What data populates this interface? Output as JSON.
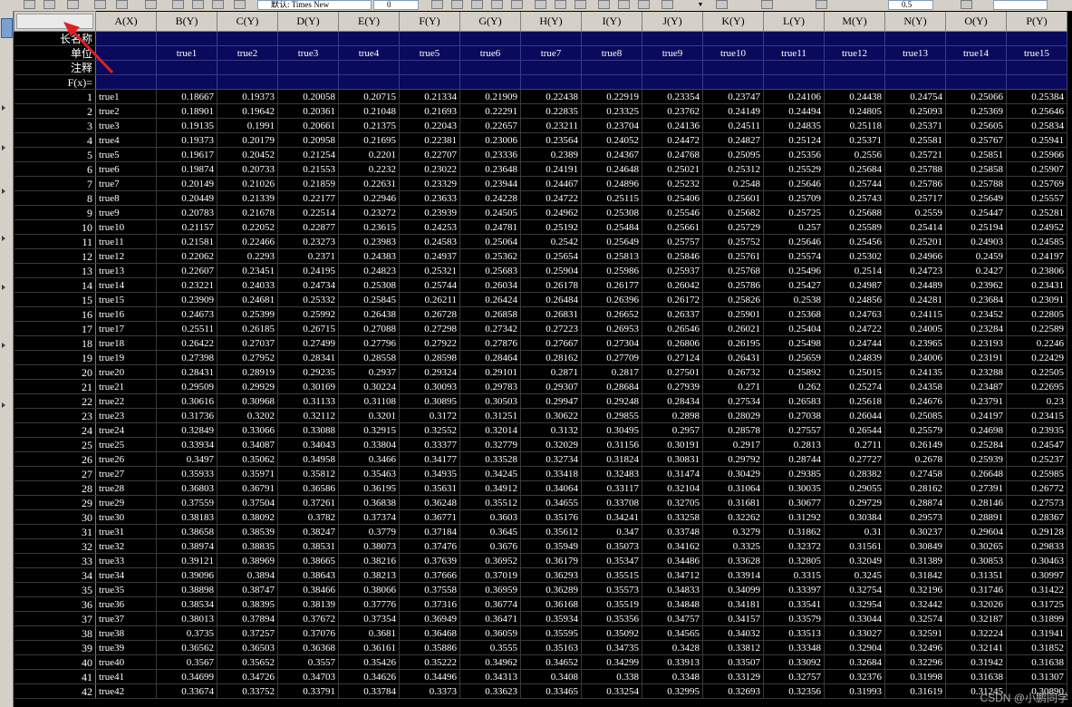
{
  "toolbar": {
    "font_name": "默认: Times New",
    "font_size": "0",
    "format_value": "0.5"
  },
  "sheet": {
    "columns": [
      "A(X)",
      "B(Y)",
      "C(Y)",
      "D(Y)",
      "E(Y)",
      "F(Y)",
      "G(Y)",
      "H(Y)",
      "I(Y)",
      "J(Y)",
      "K(Y)",
      "L(Y)",
      "M(Y)",
      "N(Y)",
      "O(Y)",
      "P(Y)"
    ],
    "meta_labels": {
      "long_name": "长名称",
      "units": "单位",
      "comments": "注释",
      "fx": "F(x)="
    },
    "units_row": [
      "",
      "true1",
      "true2",
      "true3",
      "true4",
      "true5",
      "true6",
      "true7",
      "true8",
      "true9",
      "true10",
      "true11",
      "true12",
      "true13",
      "true14",
      "true15"
    ],
    "rows": [
      [
        "1",
        "true1",
        "0.18667",
        "0.19373",
        "0.20058",
        "0.20715",
        "0.21334",
        "0.21909",
        "0.22438",
        "0.22919",
        "0.23354",
        "0.23747",
        "0.24106",
        "0.24438",
        "0.24754",
        "0.25066",
        "0.25384"
      ],
      [
        "2",
        "true2",
        "0.18901",
        "0.19642",
        "0.20361",
        "0.21048",
        "0.21693",
        "0.22291",
        "0.22835",
        "0.23325",
        "0.23762",
        "0.24149",
        "0.24494",
        "0.24805",
        "0.25093",
        "0.25369",
        "0.25646"
      ],
      [
        "3",
        "true3",
        "0.19135",
        "0.1991",
        "0.20661",
        "0.21375",
        "0.22043",
        "0.22657",
        "0.23211",
        "0.23704",
        "0.24136",
        "0.24511",
        "0.24835",
        "0.25118",
        "0.25371",
        "0.25605",
        "0.25834"
      ],
      [
        "4",
        "true4",
        "0.19373",
        "0.20179",
        "0.20958",
        "0.21695",
        "0.22381",
        "0.23006",
        "0.23564",
        "0.24052",
        "0.24472",
        "0.24827",
        "0.25124",
        "0.25371",
        "0.25581",
        "0.25767",
        "0.25941"
      ],
      [
        "5",
        "true5",
        "0.19617",
        "0.20452",
        "0.21254",
        "0.2201",
        "0.22707",
        "0.23336",
        "0.2389",
        "0.24367",
        "0.24768",
        "0.25095",
        "0.25356",
        "0.2556",
        "0.25721",
        "0.25851",
        "0.25966"
      ],
      [
        "6",
        "true6",
        "0.19874",
        "0.20733",
        "0.21553",
        "0.2232",
        "0.23022",
        "0.23648",
        "0.24191",
        "0.24648",
        "0.25021",
        "0.25312",
        "0.25529",
        "0.25684",
        "0.25788",
        "0.25858",
        "0.25907"
      ],
      [
        "7",
        "true7",
        "0.20149",
        "0.21026",
        "0.21859",
        "0.22631",
        "0.23329",
        "0.23944",
        "0.24467",
        "0.24896",
        "0.25232",
        "0.2548",
        "0.25646",
        "0.25744",
        "0.25786",
        "0.25788",
        "0.25769"
      ],
      [
        "8",
        "true8",
        "0.20449",
        "0.21339",
        "0.22177",
        "0.22946",
        "0.23633",
        "0.24228",
        "0.24722",
        "0.25115",
        "0.25406",
        "0.25601",
        "0.25709",
        "0.25743",
        "0.25717",
        "0.25649",
        "0.25557"
      ],
      [
        "9",
        "true9",
        "0.20783",
        "0.21678",
        "0.22514",
        "0.23272",
        "0.23939",
        "0.24505",
        "0.24962",
        "0.25308",
        "0.25546",
        "0.25682",
        "0.25725",
        "0.25688",
        "0.2559",
        "0.25447",
        "0.25281"
      ],
      [
        "10",
        "true10",
        "0.21157",
        "0.22052",
        "0.22877",
        "0.23615",
        "0.24253",
        "0.24781",
        "0.25192",
        "0.25484",
        "0.25661",
        "0.25729",
        "0.257",
        "0.25589",
        "0.25414",
        "0.25194",
        "0.24952"
      ],
      [
        "11",
        "true11",
        "0.21581",
        "0.22466",
        "0.23273",
        "0.23983",
        "0.24583",
        "0.25064",
        "0.2542",
        "0.25649",
        "0.25757",
        "0.25752",
        "0.25646",
        "0.25456",
        "0.25201",
        "0.24903",
        "0.24585"
      ],
      [
        "12",
        "true12",
        "0.22062",
        "0.2293",
        "0.2371",
        "0.24383",
        "0.24937",
        "0.25362",
        "0.25654",
        "0.25813",
        "0.25846",
        "0.25761",
        "0.25574",
        "0.25302",
        "0.24966",
        "0.2459",
        "0.24197"
      ],
      [
        "13",
        "true13",
        "0.22607",
        "0.23451",
        "0.24195",
        "0.24823",
        "0.25321",
        "0.25683",
        "0.25904",
        "0.25986",
        "0.25937",
        "0.25768",
        "0.25496",
        "0.2514",
        "0.24723",
        "0.2427",
        "0.23806"
      ],
      [
        "14",
        "true14",
        "0.23221",
        "0.24033",
        "0.24734",
        "0.25308",
        "0.25744",
        "0.26034",
        "0.26178",
        "0.26177",
        "0.26042",
        "0.25786",
        "0.25427",
        "0.24987",
        "0.24489",
        "0.23962",
        "0.23431"
      ],
      [
        "15",
        "true15",
        "0.23909",
        "0.24681",
        "0.25332",
        "0.25845",
        "0.26211",
        "0.26424",
        "0.26484",
        "0.26396",
        "0.26172",
        "0.25826",
        "0.2538",
        "0.24856",
        "0.24281",
        "0.23684",
        "0.23091"
      ],
      [
        "16",
        "true16",
        "0.24673",
        "0.25399",
        "0.25992",
        "0.26438",
        "0.26728",
        "0.26858",
        "0.26831",
        "0.26652",
        "0.26337",
        "0.25901",
        "0.25368",
        "0.24763",
        "0.24115",
        "0.23452",
        "0.22805"
      ],
      [
        "17",
        "true17",
        "0.25511",
        "0.26185",
        "0.26715",
        "0.27088",
        "0.27298",
        "0.27342",
        "0.27223",
        "0.26953",
        "0.26546",
        "0.26021",
        "0.25404",
        "0.24722",
        "0.24005",
        "0.23284",
        "0.22589"
      ],
      [
        "18",
        "true18",
        "0.26422",
        "0.27037",
        "0.27499",
        "0.27796",
        "0.27922",
        "0.27876",
        "0.27667",
        "0.27304",
        "0.26806",
        "0.26195",
        "0.25498",
        "0.24744",
        "0.23965",
        "0.23193",
        "0.2246"
      ],
      [
        "19",
        "true19",
        "0.27398",
        "0.27952",
        "0.28341",
        "0.28558",
        "0.28598",
        "0.28464",
        "0.28162",
        "0.27709",
        "0.27124",
        "0.26431",
        "0.25659",
        "0.24839",
        "0.24006",
        "0.23191",
        "0.22429"
      ],
      [
        "20",
        "true20",
        "0.28431",
        "0.28919",
        "0.29235",
        "0.2937",
        "0.29324",
        "0.29101",
        "0.2871",
        "0.2817",
        "0.27501",
        "0.26732",
        "0.25892",
        "0.25015",
        "0.24135",
        "0.23288",
        "0.22505"
      ],
      [
        "21",
        "true21",
        "0.29509",
        "0.29929",
        "0.30169",
        "0.30224",
        "0.30093",
        "0.29783",
        "0.29307",
        "0.28684",
        "0.27939",
        "0.271",
        "0.262",
        "0.25274",
        "0.24358",
        "0.23487",
        "0.22695"
      ],
      [
        "22",
        "true22",
        "0.30616",
        "0.30968",
        "0.31133",
        "0.31108",
        "0.30895",
        "0.30503",
        "0.29947",
        "0.29248",
        "0.28434",
        "0.27534",
        "0.26583",
        "0.25618",
        "0.24676",
        "0.23791",
        "0.23"
      ],
      [
        "23",
        "true23",
        "0.31736",
        "0.3202",
        "0.32112",
        "0.3201",
        "0.3172",
        "0.31251",
        "0.30622",
        "0.29855",
        "0.2898",
        "0.28029",
        "0.27038",
        "0.26044",
        "0.25085",
        "0.24197",
        "0.23415"
      ],
      [
        "24",
        "true24",
        "0.32849",
        "0.33066",
        "0.33088",
        "0.32915",
        "0.32552",
        "0.32014",
        "0.3132",
        "0.30495",
        "0.2957",
        "0.28578",
        "0.27557",
        "0.26544",
        "0.25579",
        "0.24698",
        "0.23935"
      ],
      [
        "25",
        "true25",
        "0.33934",
        "0.34087",
        "0.34043",
        "0.33804",
        "0.33377",
        "0.32779",
        "0.32029",
        "0.31156",
        "0.30191",
        "0.2917",
        "0.2813",
        "0.2711",
        "0.26149",
        "0.25284",
        "0.24547"
      ],
      [
        "26",
        "true26",
        "0.3497",
        "0.35062",
        "0.34958",
        "0.3466",
        "0.34177",
        "0.33528",
        "0.32734",
        "0.31824",
        "0.30831",
        "0.29792",
        "0.28744",
        "0.27727",
        "0.2678",
        "0.25939",
        "0.25237"
      ],
      [
        "27",
        "true27",
        "0.35933",
        "0.35971",
        "0.35812",
        "0.35463",
        "0.34935",
        "0.34245",
        "0.33418",
        "0.32483",
        "0.31474",
        "0.30429",
        "0.29385",
        "0.28382",
        "0.27458",
        "0.26648",
        "0.25985"
      ],
      [
        "28",
        "true28",
        "0.36803",
        "0.36791",
        "0.36586",
        "0.36195",
        "0.35631",
        "0.34912",
        "0.34064",
        "0.33117",
        "0.32104",
        "0.31064",
        "0.30035",
        "0.29055",
        "0.28162",
        "0.27391",
        "0.26772"
      ],
      [
        "29",
        "true29",
        "0.37559",
        "0.37504",
        "0.37261",
        "0.36838",
        "0.36248",
        "0.35512",
        "0.34655",
        "0.33708",
        "0.32705",
        "0.31681",
        "0.30677",
        "0.29729",
        "0.28874",
        "0.28146",
        "0.27573"
      ],
      [
        "30",
        "true30",
        "0.38183",
        "0.38092",
        "0.3782",
        "0.37374",
        "0.36771",
        "0.3603",
        "0.35176",
        "0.34241",
        "0.33258",
        "0.32262",
        "0.31292",
        "0.30384",
        "0.29573",
        "0.28891",
        "0.28367"
      ],
      [
        "31",
        "true31",
        "0.38658",
        "0.38539",
        "0.38247",
        "0.3779",
        "0.37184",
        "0.3645",
        "0.35612",
        "0.347",
        "0.33748",
        "0.3279",
        "0.31862",
        "0.31",
        "0.30237",
        "0.29604",
        "0.29128"
      ],
      [
        "32",
        "true32",
        "0.38974",
        "0.38835",
        "0.38531",
        "0.38073",
        "0.37476",
        "0.3676",
        "0.35949",
        "0.35073",
        "0.34162",
        "0.3325",
        "0.32372",
        "0.31561",
        "0.30849",
        "0.30265",
        "0.29833"
      ],
      [
        "33",
        "true33",
        "0.39121",
        "0.38969",
        "0.38665",
        "0.38216",
        "0.37639",
        "0.36952",
        "0.36179",
        "0.35347",
        "0.34486",
        "0.33628",
        "0.32805",
        "0.32049",
        "0.31389",
        "0.30853",
        "0.30463"
      ],
      [
        "34",
        "true34",
        "0.39096",
        "0.3894",
        "0.38643",
        "0.38213",
        "0.37666",
        "0.37019",
        "0.36293",
        "0.35515",
        "0.34712",
        "0.33914",
        "0.3315",
        "0.3245",
        "0.31842",
        "0.31351",
        "0.30997"
      ],
      [
        "35",
        "true35",
        "0.38898",
        "0.38747",
        "0.38466",
        "0.38066",
        "0.37558",
        "0.36959",
        "0.36289",
        "0.35573",
        "0.34833",
        "0.34099",
        "0.33397",
        "0.32754",
        "0.32196",
        "0.31746",
        "0.31422"
      ],
      [
        "36",
        "true36",
        "0.38534",
        "0.38395",
        "0.38139",
        "0.37776",
        "0.37316",
        "0.36774",
        "0.36168",
        "0.35519",
        "0.34848",
        "0.34181",
        "0.33541",
        "0.32954",
        "0.32442",
        "0.32026",
        "0.31725"
      ],
      [
        "37",
        "true37",
        "0.38013",
        "0.37894",
        "0.37672",
        "0.37354",
        "0.36949",
        "0.36471",
        "0.35934",
        "0.35356",
        "0.34757",
        "0.34157",
        "0.33579",
        "0.33044",
        "0.32574",
        "0.32187",
        "0.31899"
      ],
      [
        "38",
        "true38",
        "0.3735",
        "0.37257",
        "0.37076",
        "0.3681",
        "0.36468",
        "0.36059",
        "0.35595",
        "0.35092",
        "0.34565",
        "0.34032",
        "0.33513",
        "0.33027",
        "0.32591",
        "0.32224",
        "0.31941"
      ],
      [
        "39",
        "true39",
        "0.36562",
        "0.36503",
        "0.36368",
        "0.36161",
        "0.35886",
        "0.3555",
        "0.35163",
        "0.34735",
        "0.3428",
        "0.33812",
        "0.33348",
        "0.32904",
        "0.32496",
        "0.32141",
        "0.31852"
      ],
      [
        "40",
        "true40",
        "0.3567",
        "0.35652",
        "0.3557",
        "0.35426",
        "0.35222",
        "0.34962",
        "0.34652",
        "0.34299",
        "0.33913",
        "0.33507",
        "0.33092",
        "0.32684",
        "0.32296",
        "0.31942",
        "0.31638"
      ],
      [
        "41",
        "true41",
        "0.34699",
        "0.34726",
        "0.34703",
        "0.34626",
        "0.34496",
        "0.34313",
        "0.3408",
        "0.338",
        "0.3348",
        "0.33129",
        "0.32757",
        "0.32376",
        "0.31998",
        "0.31638",
        "0.31307"
      ],
      [
        "42",
        "true42",
        "0.33674",
        "0.33752",
        "0.33791",
        "0.33784",
        "0.3373",
        "0.33623",
        "0.33465",
        "0.33254",
        "0.32995",
        "0.32693",
        "0.32356",
        "0.31993",
        "0.31619",
        "0.31245",
        "0.30890"
      ]
    ]
  },
  "watermark": "CSDN @小鹏同学"
}
